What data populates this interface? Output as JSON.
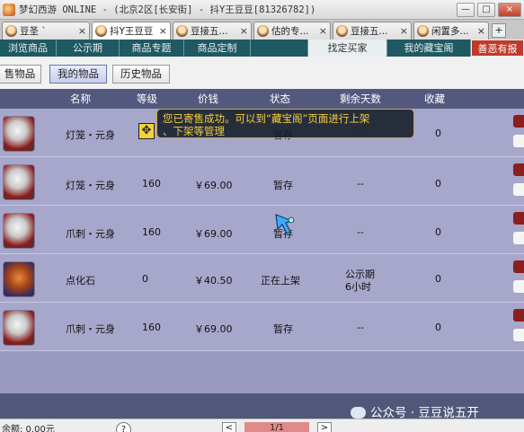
{
  "window": {
    "title": "梦幻西游 ONLINE - (北京2区[长安街] - 抖Y王豆豆[81326782])",
    "controls": {
      "minimize": "—",
      "maximize": "□",
      "close": "×"
    }
  },
  "tabs": [
    {
      "label": "豆圣 `",
      "close": "×",
      "active": false
    },
    {
      "label": "抖Y王豆豆",
      "close": "×",
      "active": true
    },
    {
      "label": "豆接五...",
      "close": "×",
      "active": false
    },
    {
      "label": "估的专...",
      "close": "×",
      "active": false
    },
    {
      "label": "豆接五...",
      "close": "×",
      "active": false
    },
    {
      "label": "闲置多...",
      "close": "×",
      "active": false
    }
  ],
  "tab_add": "+",
  "nav": {
    "items": [
      "浏览商品",
      "公示期",
      "商品专题",
      "商品定制",
      "找定买家",
      "我的藏宝阁"
    ],
    "active": "找定买家",
    "red_button": "善恶有报"
  },
  "subtabs": {
    "items": [
      "售物品",
      "我的物品",
      "历史物品"
    ],
    "active": "我的物品"
  },
  "table": {
    "headers": [
      "名称",
      "等级",
      "价钱",
      "状态",
      "剩余天数",
      "收藏"
    ],
    "rows": [
      {
        "icon": "helmet-item-icon",
        "name": "灯笼・元身",
        "level": "",
        "price": "",
        "status": "暂存",
        "days": "--",
        "fav": "0"
      },
      {
        "icon": "helmet-item-icon",
        "name": "灯笼・元身",
        "level": "160",
        "price": "￥69.00",
        "status": "暂存",
        "days": "--",
        "fav": "0"
      },
      {
        "icon": "claw-item-icon",
        "name": "爪刺・元身",
        "level": "160",
        "price": "￥69.00",
        "status": "暂存",
        "days": "--",
        "fav": "0"
      },
      {
        "icon": "gem-item-icon",
        "name": "点化石",
        "level": "0",
        "price": "￥40.50",
        "status": "正在上架",
        "days_line1": "公示期",
        "days_line2": "6小时",
        "fav": "0"
      },
      {
        "icon": "claw-item-icon",
        "name": "爪刺・元身",
        "level": "160",
        "price": "￥69.00",
        "status": "暂存",
        "days": "--",
        "fav": "0"
      }
    ]
  },
  "tooltip": {
    "line1": "您已寄售成功。可以到“藏宝阁”页面进行上架",
    "line2": "、下架等管理"
  },
  "watermark": "公众号 · 豆豆说五开",
  "footer": {
    "left": "余额: 0.00元",
    "help": "?",
    "prev": "<",
    "page": "1/1",
    "next": ">"
  },
  "colors": {
    "nav_bg": "#1f5963",
    "header_bg": "#53597e",
    "row_bg": "#a7a7cc",
    "tooltip_text": "#f5cf3a"
  }
}
